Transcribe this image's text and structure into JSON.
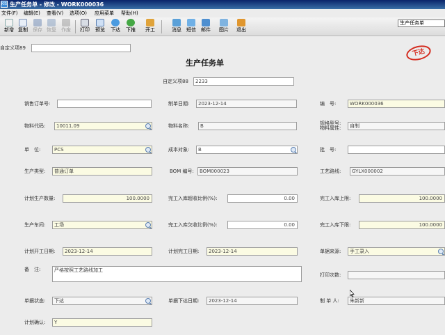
{
  "window": {
    "title": "生产任务单 - 修改 - WORK000036",
    "app_icon": "KIS"
  },
  "menu": [
    "文件(F)",
    "编辑(E)",
    "查看(V)",
    "选项(O)",
    "应用菜单",
    "帮助(H)"
  ],
  "toolbar": {
    "buttons": [
      {
        "label": "新增",
        "icon": "new-icon"
      },
      {
        "label": "复制",
        "icon": "copy-icon"
      },
      {
        "label": "保存",
        "icon": "save-icon"
      },
      {
        "label": "恢复",
        "icon": "restore-icon"
      },
      {
        "label": "作废",
        "icon": "void-icon"
      },
      {
        "label": "打印",
        "icon": "print-icon"
      },
      {
        "label": "预览",
        "icon": "preview-icon"
      },
      {
        "label": "下达",
        "icon": "issue-icon"
      },
      {
        "label": "下推",
        "icon": "push-down-icon"
      },
      {
        "label": "开工",
        "icon": "start-work-icon"
      },
      {
        "label": "消息",
        "icon": "message-icon"
      },
      {
        "label": "短信",
        "icon": "sms-icon"
      },
      {
        "label": "邮件",
        "icon": "mail-icon"
      },
      {
        "label": "图片",
        "icon": "picture-icon"
      },
      {
        "label": "退出",
        "icon": "exit-icon"
      }
    ],
    "search_value": "生产任务单"
  },
  "form": {
    "title": "生产任务单",
    "stamp": "下达",
    "custom89_label": "自定义项89",
    "custom89_value": "",
    "custom88_label": "自定义项88",
    "custom88_value": "2233",
    "fields": {
      "sales_order_no": {
        "label": "销售订单号:",
        "value": ""
      },
      "make_date": {
        "label": "制单日期:",
        "value": "2023-12-14"
      },
      "doc_no": {
        "label": "编　号:",
        "value": "WORK000036"
      },
      "material_code": {
        "label": "物料代码:",
        "value": "10011.09"
      },
      "material_name": {
        "label": "物料名称:",
        "value": "B"
      },
      "spec": {
        "label": "规格型号:",
        "label2": "物料属性:",
        "value": "自制"
      },
      "unit": {
        "label": "单　位:",
        "value": "PCS"
      },
      "cost_object": {
        "label": "成本对象:",
        "value": "B"
      },
      "batch_no": {
        "label": "批　号:",
        "value": ""
      },
      "production_type": {
        "label": "生产类型:",
        "value": "普通订单"
      },
      "bom_no": {
        "label": "BOM 编号:",
        "value": "BOM000023"
      },
      "routing": {
        "label": "工艺路线:",
        "value": "GYLX000002"
      },
      "planned_qty": {
        "label": "计划生产数量:",
        "value": "100.0000"
      },
      "over_receipt_ratio": {
        "label": "完工入库超收比例(%):",
        "value": "0.00"
      },
      "receipt_upper": {
        "label": "完工入库上限:",
        "value": "100.0000"
      },
      "workshop": {
        "label": "生产车间:",
        "value": "工场"
      },
      "under_receipt_ratio": {
        "label": "完工入库欠收比例(%):",
        "value": "0.00"
      },
      "receipt_lower": {
        "label": "完工入库下限:",
        "value": "100.0000"
      },
      "planned_start": {
        "label": "计划开工日期:",
        "value": "2023-12-14"
      },
      "planned_finish": {
        "label": "计划完工日期:",
        "value": "2023-12-14"
      },
      "doc_source": {
        "label": "单据来源:",
        "value": "手工录入"
      },
      "remark": {
        "label": "备　注:",
        "value": "严格按照工艺路线加工"
      },
      "print_count": {
        "label": "打印次数:",
        "value": ""
      },
      "doc_status": {
        "label": "单据状态:",
        "value": "下达"
      },
      "issue_date": {
        "label": "单据下达日期:",
        "value": "2023-12-14"
      },
      "maker": {
        "label": "制 单 人:",
        "value": "朱新新"
      },
      "plan_confirm": {
        "label": "计划确认:",
        "value": "Y"
      }
    }
  }
}
